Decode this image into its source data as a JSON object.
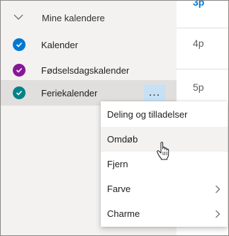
{
  "sidebar": {
    "group": {
      "label": "Mine kalendere",
      "icon": "chevron-down-icon"
    },
    "calendars": [
      {
        "label": "Kalender",
        "color": "#0078d4"
      },
      {
        "label": "Fødselsdagskalender",
        "color": "#881798"
      },
      {
        "label": "Feriekalender",
        "color": "#038387"
      }
    ],
    "more_label": "..."
  },
  "timeline": {
    "labels": [
      "3p",
      "4p",
      "5p"
    ]
  },
  "context_menu": {
    "items": [
      {
        "label": "Deling og tilladelser",
        "has_submenu": false
      },
      {
        "label": "Omdøb",
        "has_submenu": false
      },
      {
        "label": "Fjern",
        "has_submenu": false
      },
      {
        "label": "Farve",
        "has_submenu": true
      },
      {
        "label": "Charme",
        "has_submenu": true
      }
    ]
  }
}
